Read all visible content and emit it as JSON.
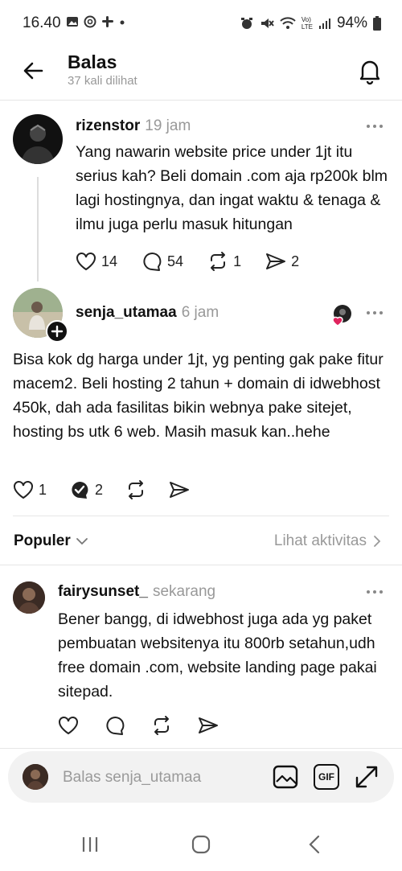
{
  "status": {
    "time": "16.40",
    "battery": "94%",
    "network_label_top": "Vo)",
    "network_label_bottom": "LTE"
  },
  "header": {
    "title": "Balas",
    "subtitle": "37 kali dilihat"
  },
  "posts": [
    {
      "username": "rizenstor",
      "time": "19 jam",
      "text": "Yang nawarin website price under 1jt itu serius kah? Beli domain .com aja rp200k blm lagi hostingnya, dan ingat waktu & tenaga & ilmu juga perlu masuk hitungan",
      "likes": "14",
      "replies": "54",
      "reposts": "1",
      "shares": "2"
    },
    {
      "username": "senja_utamaa",
      "time": "6 jam",
      "text": "Bisa kok dg harga under 1jt, yg penting gak pake fitur macem2. Beli hosting 2 tahun + domain di idwebhost 450k,  dah ada fasilitas bikin webnya pake sitejet, hosting bs utk 6 web. Masih masuk kan..hehe",
      "likes": "1",
      "replies": "2"
    }
  ],
  "sort": {
    "label": "Populer",
    "activity_link": "Lihat aktivitas"
  },
  "comments": [
    {
      "username": "fairysunset_",
      "time": "sekarang",
      "text": "Bener bangg, di idwebhost juga ada yg paket pembuatan websitenya itu 800rb setahun,udh free domain .com, website landing page pakai sitepad."
    }
  ],
  "reply_bar": {
    "placeholder": "Balas senja_utamaa",
    "gif_label": "GIF"
  },
  "colors": {
    "accent_heart": "#e0245e",
    "muted_text": "#999999"
  }
}
